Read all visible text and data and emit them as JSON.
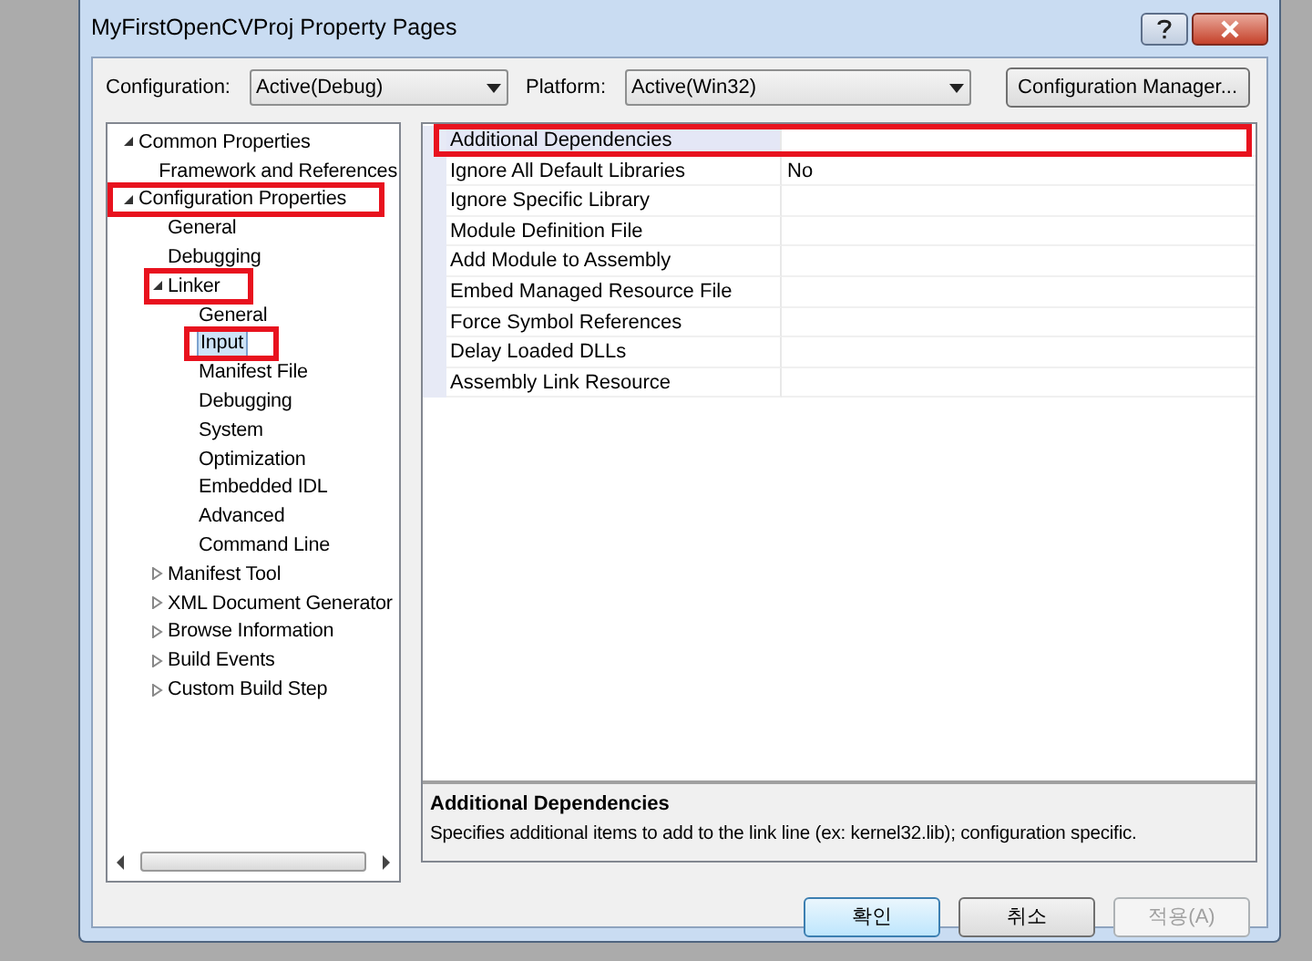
{
  "window": {
    "title": "MyFirstOpenCVProj Property Pages"
  },
  "config_bar": {
    "configuration": {
      "label": "Configuration:",
      "value": "Active(Debug)"
    },
    "platform": {
      "label": "Platform:",
      "value": "Active(Win32)"
    },
    "manager_button": "Configuration Manager..."
  },
  "tree": [
    {
      "label": "Common Properties",
      "kind": "branch",
      "expanded": true,
      "selected": false,
      "highlighted": false,
      "children": [
        {
          "label": "Framework and References",
          "kind": "leaf",
          "selected": false,
          "highlighted": false
        }
      ]
    },
    {
      "label": "Configuration Properties",
      "kind": "branch",
      "expanded": true,
      "selected": false,
      "highlighted": true,
      "children": [
        {
          "label": "General",
          "kind": "leaf",
          "selected": false,
          "highlighted": false
        },
        {
          "label": "Debugging",
          "kind": "leaf",
          "selected": false,
          "highlighted": false
        },
        {
          "label": "Linker",
          "kind": "branch",
          "expanded": true,
          "selected": false,
          "highlighted": true,
          "children": [
            {
              "label": "General",
              "kind": "leaf",
              "selected": false,
              "highlighted": false
            },
            {
              "label": "Input",
              "kind": "leaf",
              "selected": true,
              "highlighted": true
            },
            {
              "label": "Manifest File",
              "kind": "leaf",
              "selected": false,
              "highlighted": false
            },
            {
              "label": "Debugging",
              "kind": "leaf",
              "selected": false,
              "highlighted": false
            },
            {
              "label": "System",
              "kind": "leaf",
              "selected": false,
              "highlighted": false
            },
            {
              "label": "Optimization",
              "kind": "leaf",
              "selected": false,
              "highlighted": false
            },
            {
              "label": "Embedded IDL",
              "kind": "leaf",
              "selected": false,
              "highlighted": false
            },
            {
              "label": "Advanced",
              "kind": "leaf",
              "selected": false,
              "highlighted": false
            },
            {
              "label": "Command Line",
              "kind": "leaf",
              "selected": false,
              "highlighted": false
            }
          ]
        },
        {
          "label": "Manifest Tool",
          "kind": "branch",
          "expanded": false,
          "selected": false,
          "highlighted": false
        },
        {
          "label": "XML Document Generator",
          "kind": "branch",
          "expanded": false,
          "selected": false,
          "highlighted": false
        },
        {
          "label": "Browse Information",
          "kind": "branch",
          "expanded": false,
          "selected": false,
          "highlighted": false
        },
        {
          "label": "Build Events",
          "kind": "branch",
          "expanded": false,
          "selected": false,
          "highlighted": false
        },
        {
          "label": "Custom Build Step",
          "kind": "branch",
          "expanded": false,
          "selected": false,
          "highlighted": false
        }
      ]
    }
  ],
  "properties": [
    {
      "name": "Additional Dependencies",
      "selected": true,
      "highlighted": true
    },
    {
      "name": "Ignore All Default Libraries",
      "value": "No",
      "selected": false,
      "highlighted": false
    },
    {
      "name": "Ignore Specific Library",
      "selected": false,
      "highlighted": false
    },
    {
      "name": "Module Definition File",
      "selected": false,
      "highlighted": false
    },
    {
      "name": "Add Module to Assembly",
      "selected": false,
      "highlighted": false
    },
    {
      "name": "Embed Managed Resource File",
      "selected": false,
      "highlighted": false
    },
    {
      "name": "Force Symbol References",
      "selected": false,
      "highlighted": false
    },
    {
      "name": "Delay Loaded DLLs",
      "selected": false,
      "highlighted": false
    },
    {
      "name": "Assembly Link Resource",
      "selected": false,
      "highlighted": false
    }
  ],
  "description": {
    "title": "Additional Dependencies",
    "text": "Specifies additional items to add to the link line (ex: kernel32.lib); configuration specific."
  },
  "buttons": [
    {
      "label": "확인",
      "kind": "default",
      "disabled": false
    },
    {
      "label": "취소",
      "kind": "normal",
      "disabled": false
    },
    {
      "label": "적용(A)",
      "kind": "normal",
      "disabled": true
    }
  ]
}
